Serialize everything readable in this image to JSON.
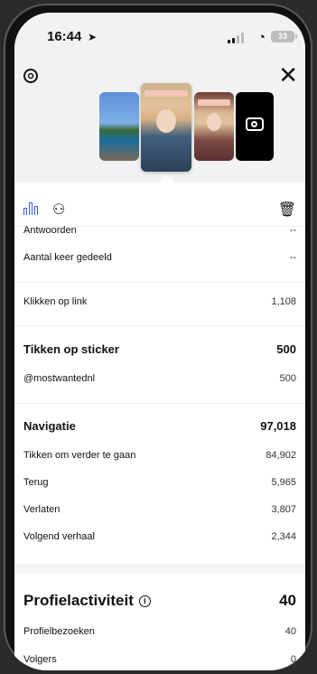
{
  "status": {
    "time": "16:44",
    "battery": "33"
  },
  "rows": {
    "antwoorden": {
      "label": "Antwoorden",
      "value": "--"
    },
    "gedeeld": {
      "label": "Aantal keer gedeeld",
      "value": "--"
    },
    "klikken": {
      "label": "Klikken op link",
      "value": "1,108"
    },
    "sticker": {
      "label": "Tikken op sticker",
      "value": "500"
    },
    "mostwanted": {
      "label": "@mostwantednl",
      "value": "500"
    },
    "navigatie": {
      "label": "Navigatie",
      "value": "97,018"
    },
    "verder": {
      "label": "Tikken om verder te gaan",
      "value": "84,902"
    },
    "terug": {
      "label": "Terug",
      "value": "5,965"
    },
    "verlaten": {
      "label": "Verlaten",
      "value": "3,807"
    },
    "volgend": {
      "label": "Volgend verhaal",
      "value": "2,344"
    },
    "profielbezoeken": {
      "label": "Profielbezoeken",
      "value": "40"
    },
    "volgers": {
      "label": "Volgers",
      "value": "0"
    }
  },
  "profile": {
    "label": "Profielactiviteit",
    "value": "40"
  },
  "icons": {
    "settings": "settings-icon",
    "close": "close-icon",
    "chart": "bar-chart-icon",
    "people": "people-icon",
    "trash": "trash-icon",
    "camera": "camera-icon",
    "info": "info-icon"
  },
  "colors": {
    "accent": "#3b5bdb"
  }
}
